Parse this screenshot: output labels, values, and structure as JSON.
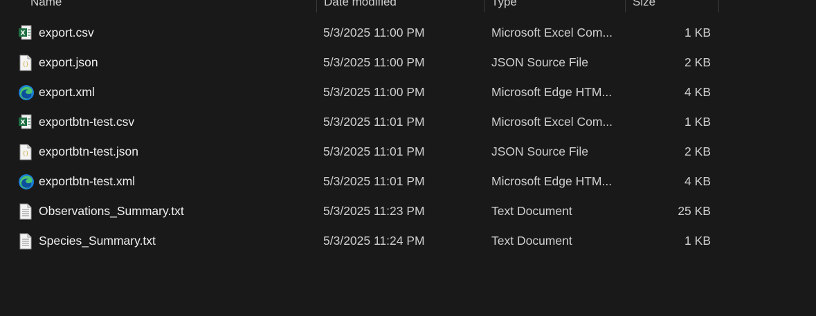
{
  "columns": {
    "name": "Name",
    "date": "Date modified",
    "type": "Type",
    "size": "Size"
  },
  "files": [
    {
      "icon": "excel-csv-icon",
      "name": "export.csv",
      "date": "5/3/2025 11:00 PM",
      "type": "Microsoft Excel Com...",
      "size": "1 KB"
    },
    {
      "icon": "json-file-icon",
      "name": "export.json",
      "date": "5/3/2025 11:00 PM",
      "type": "JSON Source File",
      "size": "2 KB"
    },
    {
      "icon": "edge-icon",
      "name": "export.xml",
      "date": "5/3/2025 11:00 PM",
      "type": "Microsoft Edge HTM...",
      "size": "4 KB"
    },
    {
      "icon": "excel-csv-icon",
      "name": "exportbtn-test.csv",
      "date": "5/3/2025 11:01 PM",
      "type": "Microsoft Excel Com...",
      "size": "1 KB"
    },
    {
      "icon": "json-file-icon",
      "name": "exportbtn-test.json",
      "date": "5/3/2025 11:01 PM",
      "type": "JSON Source File",
      "size": "2 KB"
    },
    {
      "icon": "edge-icon",
      "name": "exportbtn-test.xml",
      "date": "5/3/2025 11:01 PM",
      "type": "Microsoft Edge HTM...",
      "size": "4 KB"
    },
    {
      "icon": "text-file-icon",
      "name": "Observations_Summary.txt",
      "date": "5/3/2025 11:23 PM",
      "type": "Text Document",
      "size": "25 KB"
    },
    {
      "icon": "text-file-icon",
      "name": "Species_Summary.txt",
      "date": "5/3/2025 11:24 PM",
      "type": "Text Document",
      "size": "1 KB"
    }
  ]
}
